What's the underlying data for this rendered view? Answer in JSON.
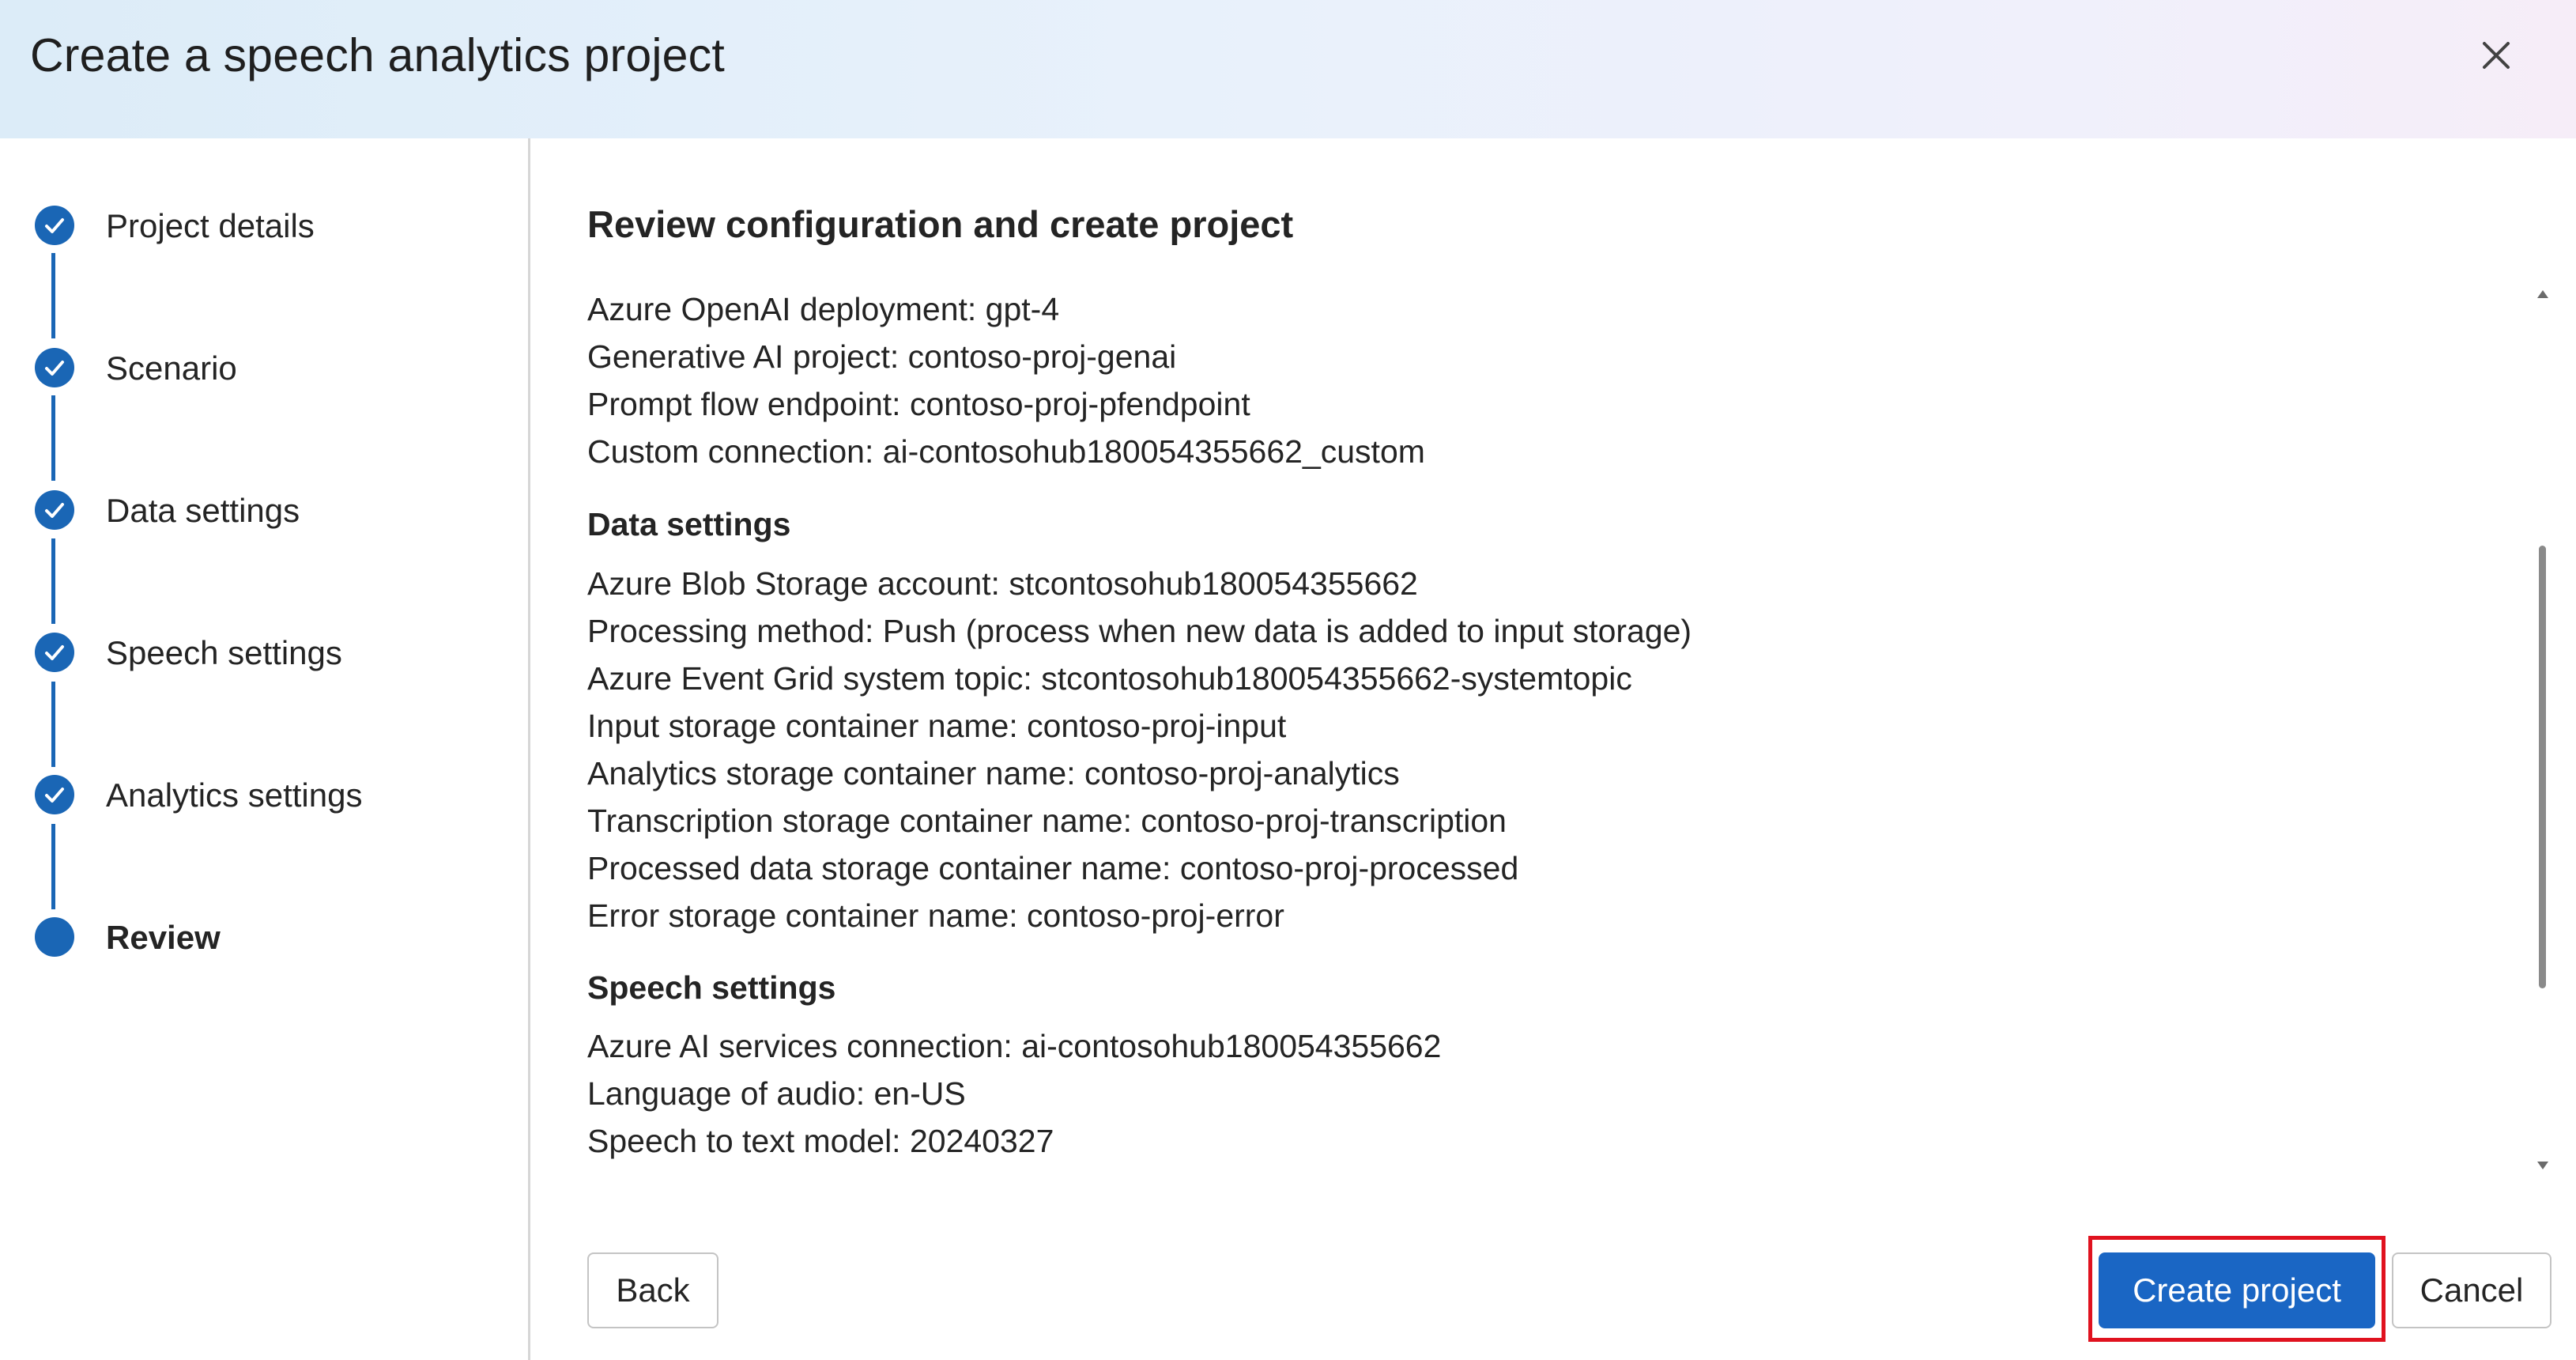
{
  "dialog": {
    "title": "Create a speech analytics project"
  },
  "steps": [
    {
      "label": "Project details",
      "status": "completed"
    },
    {
      "label": "Scenario",
      "status": "completed"
    },
    {
      "label": "Data settings",
      "status": "completed"
    },
    {
      "label": "Speech settings",
      "status": "completed"
    },
    {
      "label": "Analytics settings",
      "status": "completed"
    },
    {
      "label": "Review",
      "status": "current"
    }
  ],
  "review": {
    "title": "Review configuration and create project",
    "scenario_lines": [
      "Azure OpenAI deployment: gpt-4",
      "Generative AI project: contoso-proj-genai",
      "Prompt flow endpoint: contoso-proj-pfendpoint",
      "Custom connection: ai-contosohub180054355662_custom"
    ],
    "data_settings": {
      "heading": "Data settings",
      "lines": [
        "Azure Blob Storage account: stcontosohub180054355662",
        "Processing method: Push (process when new data is added to input storage)",
        "Azure Event Grid system topic: stcontosohub180054355662-systemtopic",
        "Input storage container name: contoso-proj-input",
        "Analytics storage container name: contoso-proj-analytics",
        "Transcription storage container name: contoso-proj-transcription",
        "Processed data storage container name: contoso-proj-processed",
        "Error storage container name: contoso-proj-error"
      ]
    },
    "speech_settings": {
      "heading": "Speech settings",
      "lines": [
        "Azure AI services connection: ai-contosohub180054355662",
        "Language of audio: en-US",
        "Speech to text model: 20240327"
      ]
    }
  },
  "buttons": {
    "back": "Back",
    "create": "Create project",
    "cancel": "Cancel"
  },
  "colors": {
    "accent": "#1a66c4",
    "step": "#1a66b5",
    "highlight": "#e0121f"
  }
}
